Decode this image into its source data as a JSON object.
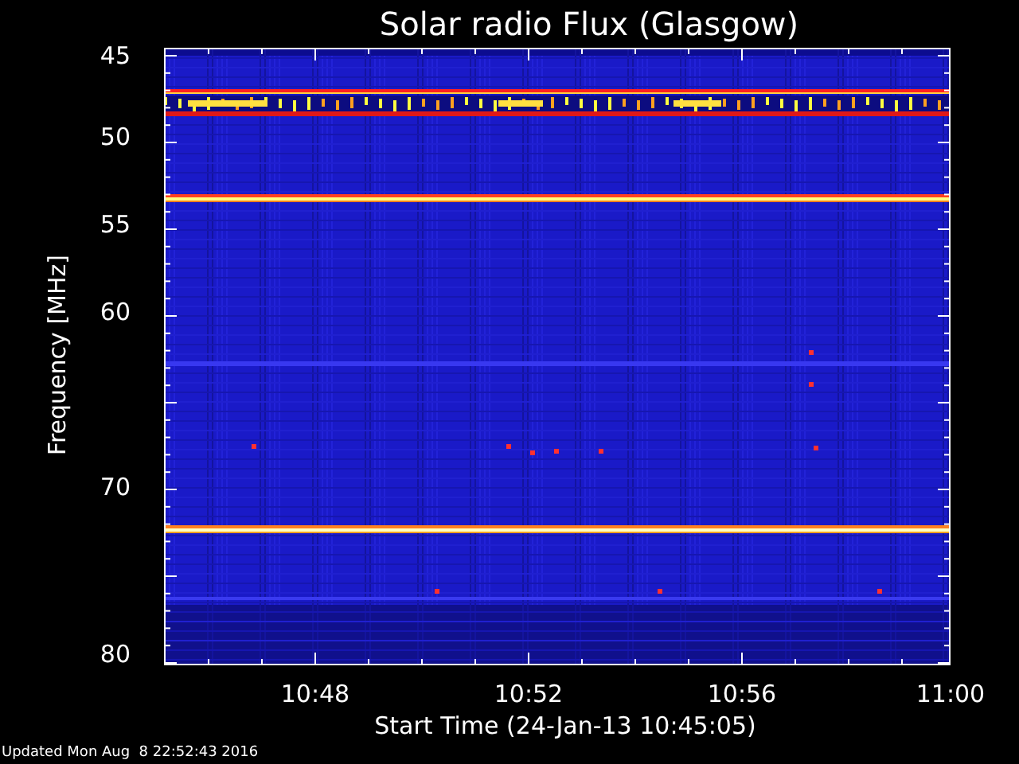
{
  "title": "Solar radio Flux (Glasgow)",
  "y_axis": {
    "label": "Frequency [MHz]",
    "ticks": [
      "45",
      "50",
      "55",
      "60",
      "70",
      "80"
    ]
  },
  "x_axis": {
    "label": "Start Time (24-Jan-13 10:45:05)",
    "ticks": [
      "10:48",
      "10:52",
      "10:56",
      "11:00"
    ]
  },
  "footer": "Updated Mon Aug  8 22:52:43 2016"
}
